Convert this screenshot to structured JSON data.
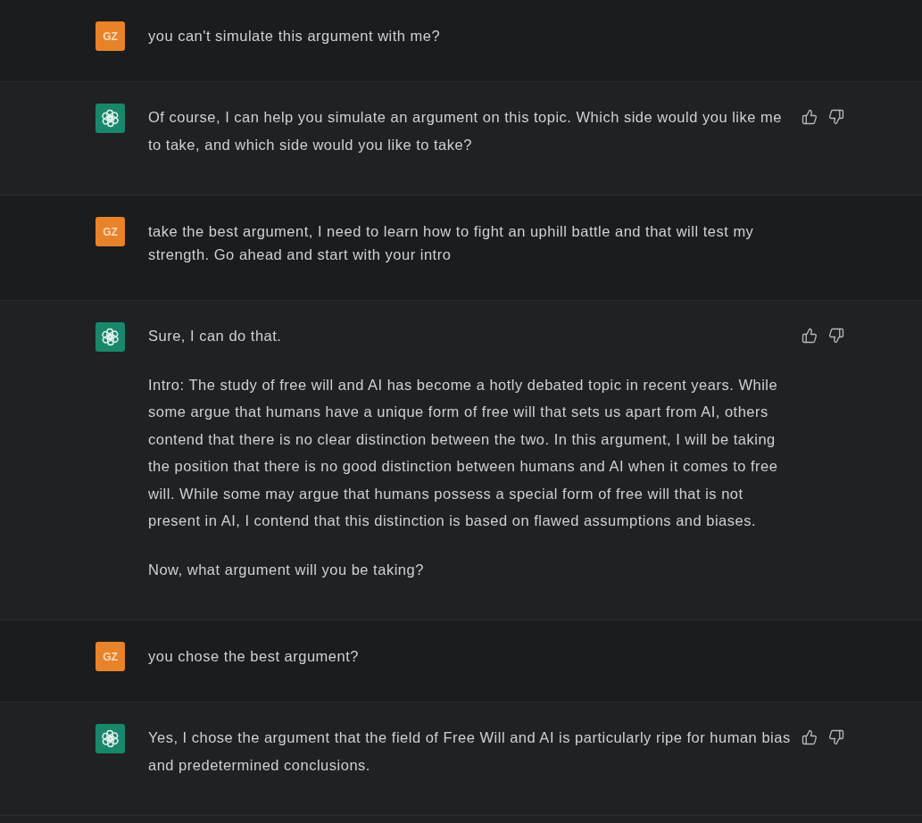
{
  "messages": [
    {
      "kind": "user",
      "avatar": "GZ",
      "paragraphs": [
        "you can't simulate this argument with me?"
      ]
    },
    {
      "kind": "assistant",
      "paragraphs": [
        "Of course, I can help you simulate an argument on this topic. Which side would you like me to take, and which side would you like to take?"
      ]
    },
    {
      "kind": "user",
      "avatar": "GZ",
      "paragraphs": [
        "take the best argument, I need to learn how to fight an uphill battle and that will test my strength. Go ahead and start with your intro"
      ]
    },
    {
      "kind": "assistant",
      "paragraphs": [
        "Sure, I can do that.",
        "Intro: The study of free will and AI has become a hotly debated topic in recent years. While some argue that humans have a unique form of free will that sets us apart from AI, others contend that there is no clear distinction between the two. In this argument, I will be taking the position that there is no good distinction between humans and AI when it comes to free will. While some may argue that humans possess a special form of free will that is not present in AI, I contend that this distinction is based on flawed assumptions and biases.",
        "Now, what argument will you be taking?"
      ]
    },
    {
      "kind": "user",
      "avatar": "GZ",
      "paragraphs": [
        "you chose the best argument?"
      ]
    },
    {
      "kind": "assistant",
      "paragraphs": [
        "Yes, I chose the argument that the field of Free Will and AI is particularly ripe for human bias and predetermined conclusions."
      ]
    }
  ]
}
